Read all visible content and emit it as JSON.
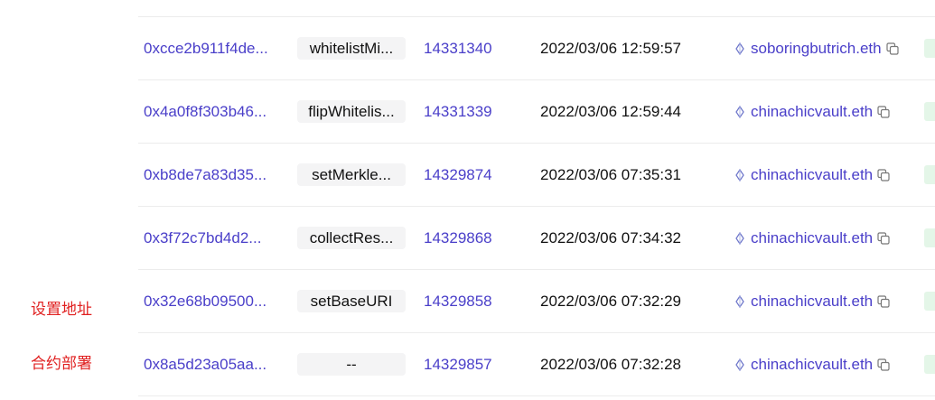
{
  "annotations": {
    "set_address": "设置地址",
    "contract_deploy": "合约部署"
  },
  "icons": {
    "from_prefix": "eth-diamond-icon",
    "copy": "copy-icon"
  },
  "colors": {
    "link": "#4a3fc9",
    "annotation": "#e02020",
    "method_bg": "#f4f4f5",
    "status_bg": "#e4f6e8"
  },
  "rows": [
    {
      "hash": "0xcce2b911f4de...",
      "method": "whitelistMi...",
      "block": "14331340",
      "time": "2022/03/06 12:59:57",
      "from": "soboringbutrich.eth"
    },
    {
      "hash": "0x4a0f8f303b46...",
      "method": "flipWhitelis...",
      "block": "14331339",
      "time": "2022/03/06 12:59:44",
      "from": "chinachicvault.eth"
    },
    {
      "hash": "0xb8de7a83d35...",
      "method": "setMerkle...",
      "block": "14329874",
      "time": "2022/03/06 07:35:31",
      "from": "chinachicvault.eth"
    },
    {
      "hash": "0x3f72c7bd4d2...",
      "method": "collectRes...",
      "block": "14329868",
      "time": "2022/03/06 07:34:32",
      "from": "chinachicvault.eth"
    },
    {
      "hash": "0x32e68b09500...",
      "method": "setBaseURI",
      "block": "14329858",
      "time": "2022/03/06 07:32:29",
      "from": "chinachicvault.eth"
    },
    {
      "hash": "0x8a5d23a05aa...",
      "method": "--",
      "block": "14329857",
      "time": "2022/03/06 07:32:28",
      "from": "chinachicvault.eth"
    }
  ]
}
